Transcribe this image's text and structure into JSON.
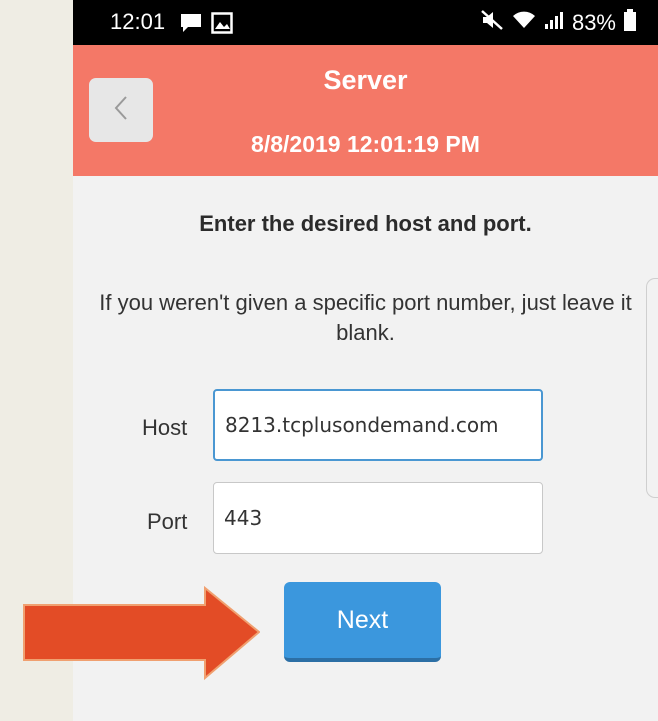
{
  "status_bar": {
    "time": "12:01",
    "battery": "83%",
    "icons": [
      "chat-bubble-icon",
      "gallery-icon",
      "mute-icon",
      "wifi-icon",
      "signal-icon",
      "battery-icon"
    ]
  },
  "header": {
    "title": "Server",
    "datetime": "8/8/2019 12:01:19 PM",
    "back_icon": "chevron-left-icon",
    "color": "#f47867"
  },
  "instructions": "Enter the desired host and port.",
  "hint": "If you weren't given a specific port number, just leave it blank.",
  "form": {
    "host_label": "Host",
    "host_value": "8213.tcplusondemand.com",
    "port_label": "Port",
    "port_value": "443"
  },
  "next_button": {
    "label": "Next",
    "color": "#3b97dd"
  },
  "annotation": {
    "arrow_color": "#e34c26"
  }
}
